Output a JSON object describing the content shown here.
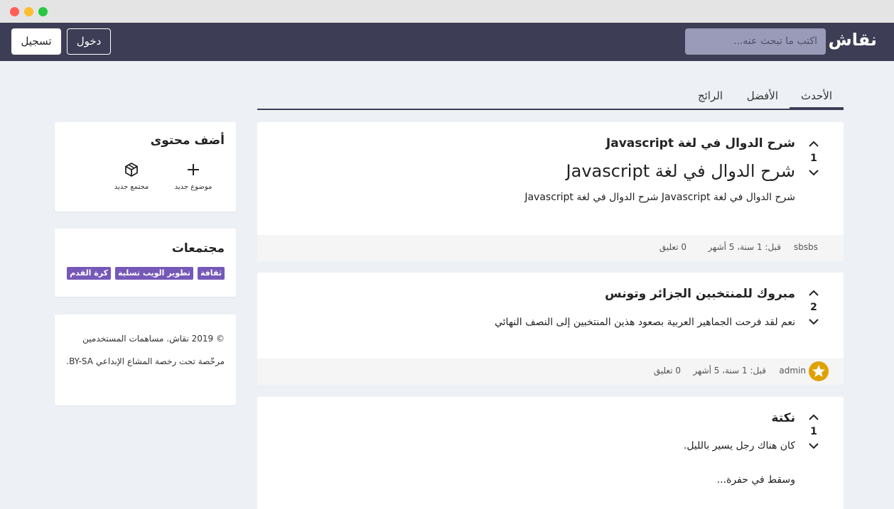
{
  "window": {
    "controls": [
      {
        "name": "close",
        "color": "#fe5f57"
      },
      {
        "name": "minimize",
        "color": "#febc2e"
      },
      {
        "name": "maximize",
        "color": "#28c840"
      }
    ]
  },
  "navbar": {
    "brand": "نقاش",
    "search_placeholder": "اكتب ما تبحث عنه...",
    "login_label": "دخول",
    "register_label": "تسجيل"
  },
  "tabs": [
    {
      "label": "الأحدث",
      "active": true
    },
    {
      "label": "الأفضل",
      "active": false
    },
    {
      "label": "الرائج",
      "active": false
    }
  ],
  "posts": [
    {
      "title": "شرح الدوال في لغة Javascript",
      "votes": "1",
      "heading": "شرح الدوال في لغة Javascript",
      "body": "شرح الدوال في لغة Javascript شرح الدوال في لغة Javascript",
      "author": "sbsbs",
      "time": "قبل: 1 سنة، 5 أشهر",
      "comments": "0 تعليق"
    },
    {
      "title": "مبروك للمنتخبين الجزائر وتونس",
      "votes": "2",
      "body": "نعم لقد فرحت الجماهير العربية بصعود هذين المنتخبين إلى النصف النهائي",
      "author": "admin",
      "author_icon": "star-badge-icon",
      "time": "قبل: 1 سنة، 5 أشهر",
      "comments": "0 تعليق"
    },
    {
      "title": "نكتة",
      "votes": "1",
      "body_lines": [
        "كان هناك رجل يسير بالليل.",
        "وسقط في حفرة..."
      ]
    }
  ],
  "sidebar": {
    "add_content": {
      "title": "أضف محتوى",
      "actions": [
        {
          "label": "موضوع جديد",
          "icon": "plus-icon"
        },
        {
          "label": "مجتمع جديد",
          "icon": "cube-icon"
        }
      ]
    },
    "communities": {
      "title": "مجتمعات",
      "tags": [
        "ثقافة",
        "تطوير الويب",
        "تسلية",
        "كرة القدم"
      ],
      "tag_color": "#7658b8"
    },
    "footer_text": "© 2019 نقاش. مساهمات المستخدمين مرخّصة تحت رخصة المشاع الإبداعي BY-SA."
  },
  "colors": {
    "navbar": "#3d3e55",
    "background": "#edf1f5",
    "accent": "#7658b8"
  }
}
